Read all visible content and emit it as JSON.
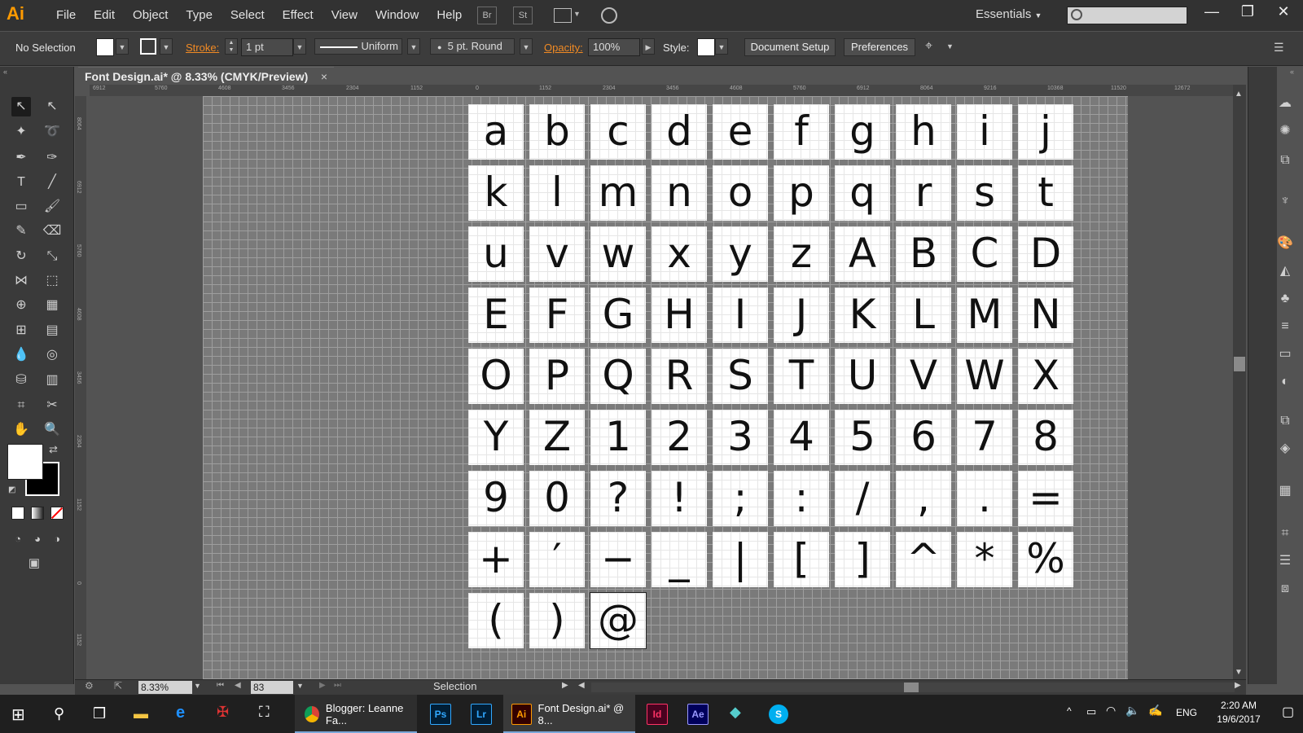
{
  "app": {
    "logo": "Ai",
    "menu": [
      "File",
      "Edit",
      "Object",
      "Type",
      "Select",
      "Effect",
      "View",
      "Window",
      "Help"
    ],
    "bridge_labels": [
      "Br",
      "St"
    ],
    "workspace": "Essentials",
    "window_controls": [
      "minimize-icon",
      "restore-icon",
      "close-icon"
    ]
  },
  "control_bar": {
    "selection_label": "No Selection",
    "stroke_label": "Stroke:",
    "stroke_weight": "1 pt",
    "stroke_profile": "Uniform",
    "brush": "5 pt. Round",
    "opacity_label": "Opacity:",
    "opacity_value": "100%",
    "style_label": "Style:",
    "document_setup": "Document Setup",
    "preferences": "Preferences"
  },
  "document": {
    "tab_title": "Font Design.ai* @ 8.33% (CMYK/Preview)",
    "close_label": "×",
    "ruler_top_ticks": [
      "6912",
      "5760",
      "4608",
      "3456",
      "2304",
      "1152",
      "0",
      "1152",
      "2304",
      "3456",
      "4608",
      "5760",
      "6912",
      "8064",
      "9216",
      "10368",
      "11520",
      "12672"
    ],
    "ruler_left_ticks": [
      "8064",
      "6912",
      "5760",
      "4608",
      "3456",
      "2304",
      "1152",
      "0",
      "1152"
    ]
  },
  "glyphs": [
    [
      "a",
      "b",
      "c",
      "d",
      "e",
      "f",
      "g",
      "h",
      "i",
      "j"
    ],
    [
      "k",
      "l",
      "m",
      "n",
      "o",
      "p",
      "q",
      "r",
      "s",
      "t"
    ],
    [
      "u",
      "v",
      "w",
      "x",
      "y",
      "z",
      "A",
      "B",
      "C",
      "D"
    ],
    [
      "E",
      "F",
      "G",
      "H",
      "I",
      "J",
      "K",
      "L",
      "M",
      "N"
    ],
    [
      "O",
      "P",
      "Q",
      "R",
      "S",
      "T",
      "U",
      "V",
      "W",
      "X"
    ],
    [
      "Y",
      "Z",
      "1",
      "2",
      "3",
      "4",
      "5",
      "6",
      "7",
      "8"
    ],
    [
      "9",
      "0",
      "?",
      "!",
      ";",
      ":",
      "/",
      ",",
      ".",
      "="
    ],
    [
      "+",
      "′",
      "−",
      "_",
      "|",
      "[",
      "]",
      "^",
      "*",
      "%"
    ],
    [
      "(",
      ")",
      "@"
    ]
  ],
  "status_bar": {
    "zoom": "8.33%",
    "artboard": "83",
    "tool": "Selection"
  },
  "taskbar": {
    "apps": [
      {
        "icon": "chrome-icon",
        "label": "Blogger: Leanne Fa..."
      },
      {
        "icon": "photoshop-icon",
        "label": "Ps"
      },
      {
        "icon": "lightroom-icon",
        "label": "Lr"
      },
      {
        "icon": "illustrator-icon",
        "label": "Ai",
        "title": "Font Design.ai* @ 8..."
      },
      {
        "icon": "indesign-icon",
        "label": "Id"
      },
      {
        "icon": "aftereffects-icon",
        "label": "Ae"
      },
      {
        "icon": "skype-icon",
        "label": "S"
      }
    ],
    "lang": "ENG",
    "time": "2:20 AM",
    "date": "19/6/2017"
  },
  "colors": {
    "accent": "#ff9a00",
    "orange_label": "#f08a24",
    "ps": "#31a8ff",
    "lr": "#31a8ff",
    "id": "#ff3366",
    "ae": "#9999ff"
  }
}
